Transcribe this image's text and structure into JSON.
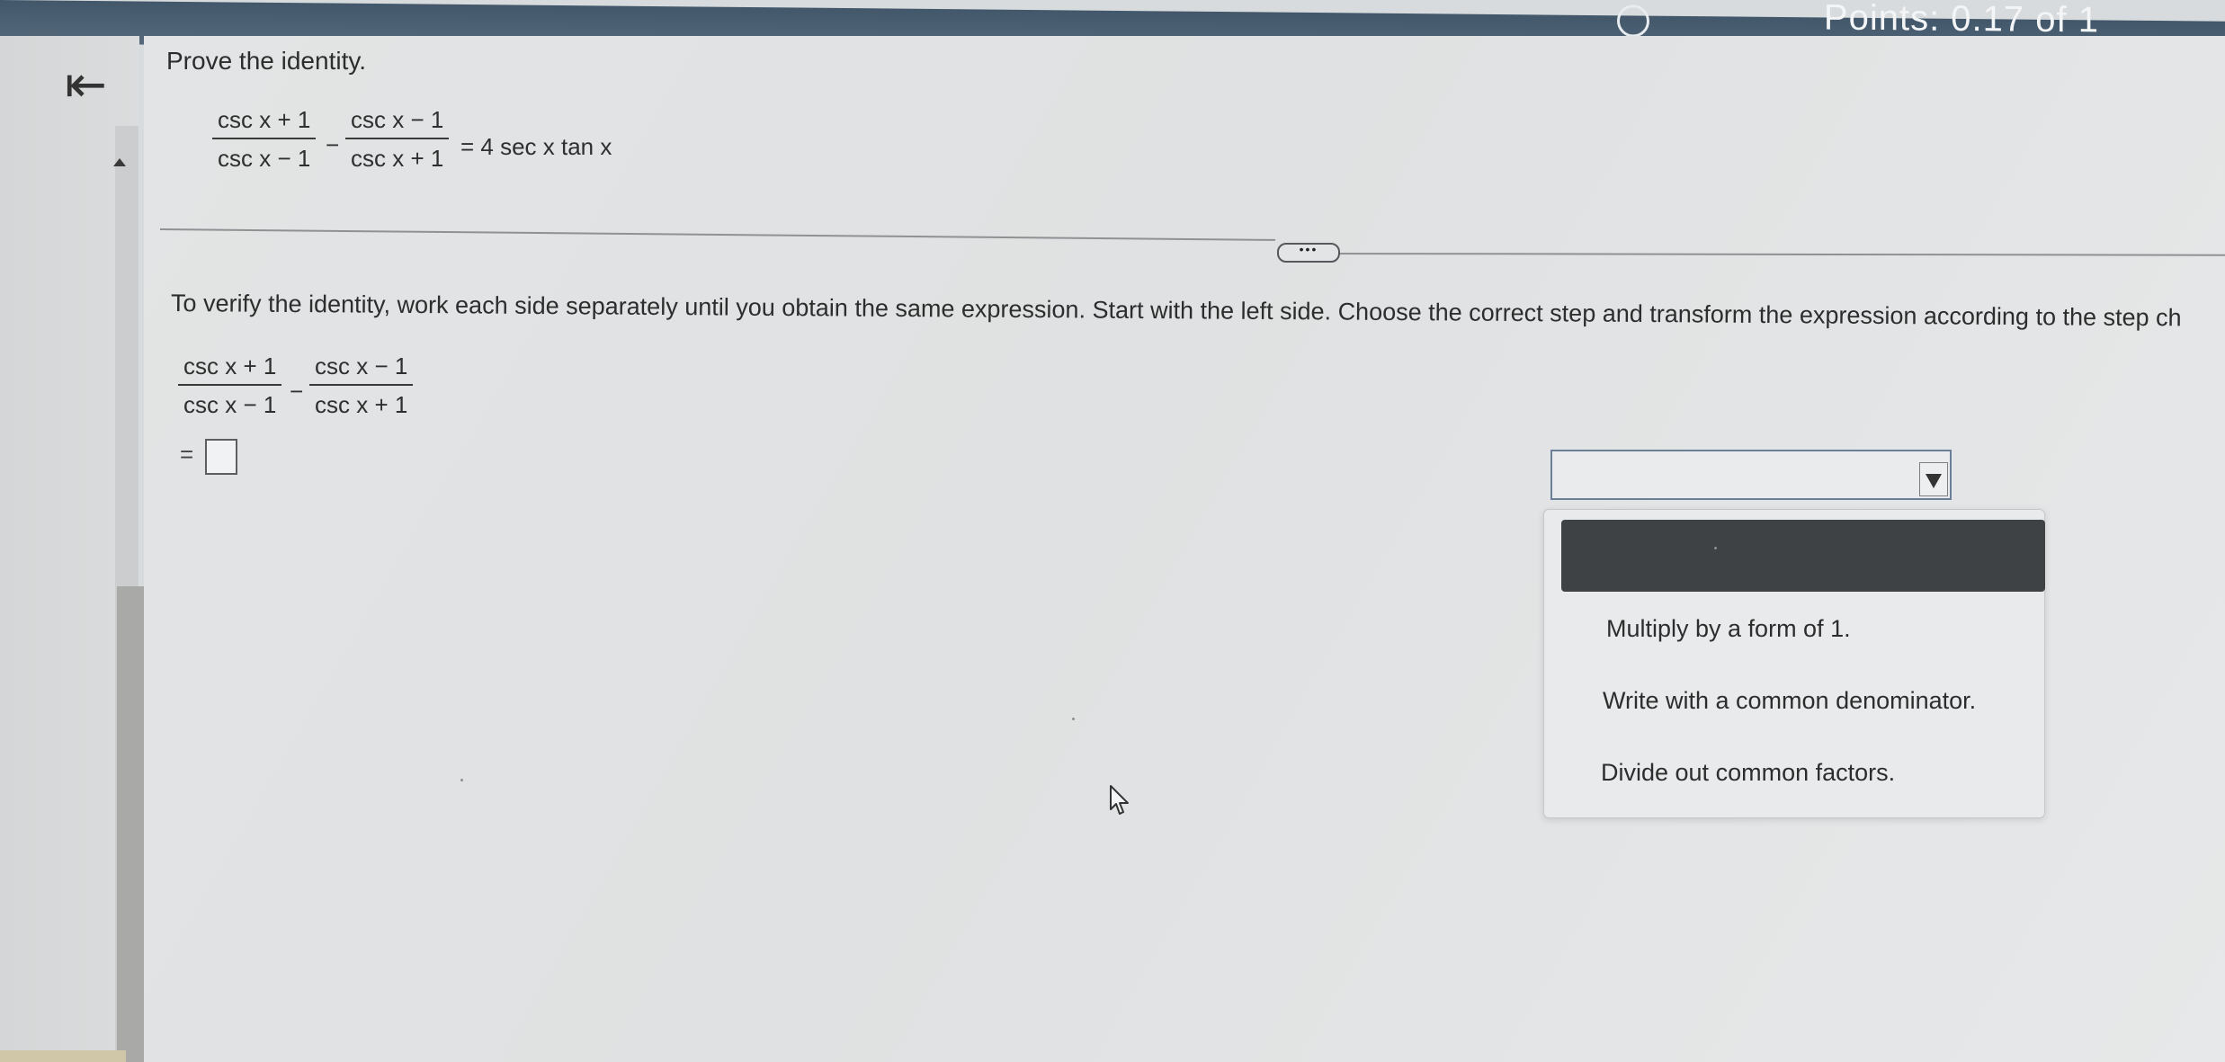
{
  "header": {
    "points_label": "Points: 0.17 of 1"
  },
  "question": {
    "prompt": "Prove the identity.",
    "identity": {
      "term1_num": "csc x + 1",
      "term1_den": "csc x − 1",
      "minus": "−",
      "term2_num": "csc x − 1",
      "term2_den": "csc x + 1",
      "rhs": "= 4 sec x tan x"
    }
  },
  "more_button_label": "•••",
  "work": {
    "instruction": "To verify the identity, work each side separately until you obtain the same expression. Start with the left side. Choose the correct step and transform the expression according to the step ch",
    "lhs": {
      "term1_num": "csc x + 1",
      "term1_den": "csc x − 1",
      "minus": "−",
      "term2_num": "csc x − 1",
      "term2_den": "csc x + 1"
    },
    "equals": "=",
    "answer_value": ""
  },
  "step_dropdown": {
    "selected": "",
    "options": [
      "Multiply by a form of 1.",
      "Write with a common denominator.",
      "Divide out common factors."
    ]
  }
}
